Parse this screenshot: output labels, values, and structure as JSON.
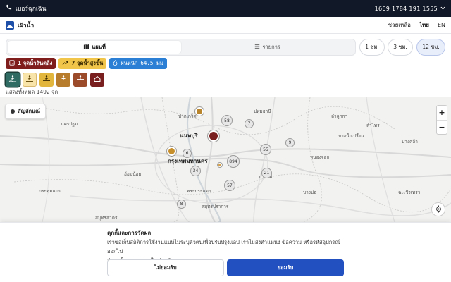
{
  "topbar": {
    "emergency_label": "เบอร์ฉุกเฉิน",
    "phones": "1669  1784  191  1555"
  },
  "header": {
    "app_name": "เฝ้าน้ำ",
    "help": "ช่วยเหลือ",
    "lang_th": "ไทย",
    "lang_en": "EN"
  },
  "view_toggle": {
    "map": "แผนที่",
    "list": "รายการ"
  },
  "time_ranges": [
    {
      "label": "1 ชม."
    },
    {
      "label": "3 ชม."
    },
    {
      "label": "12 ชม.",
      "active": true
    }
  ],
  "stats": {
    "critical": "1 จุดน้ำล้นตลิ่ง",
    "rising": "7 จุดน้ำสูงขึ้น",
    "rain_label": "ฝนหนัก",
    "rain_value": "64.5 มม"
  },
  "filters": [
    {
      "name": "filter-all",
      "color": "#2f6b63"
    },
    {
      "name": "filter-normal",
      "color": "#f8e3a8"
    },
    {
      "name": "filter-watch",
      "color": "#e2b53c"
    },
    {
      "name": "filter-warning",
      "color": "#b87d2c"
    },
    {
      "name": "filter-danger",
      "color": "#9b4a2a"
    },
    {
      "name": "filter-critical",
      "color": "#7a1f1f"
    }
  ],
  "count_text": "แสดงทั้งหมด 1492 จุด",
  "map": {
    "legend": "สัญลักษณ์",
    "labels": {
      "bangkok": "กรุงเทพมหานคร",
      "nonthaburi": "นนทบุรี",
      "pakkret": "ปากเกร็ด",
      "nakhonpathom": "นครปฐม",
      "samutprakan": "สมุทรปราการ",
      "samutsakhon": "สมุทรสาคร",
      "omnoi": "อ้อมน้อย",
      "pathumthani": "ปทุมธานี",
      "lamlukka": "ลำลูกกา",
      "bangnamprieo": "บางน้ำเปรี้ยว",
      "bangbo": "บางบ่อ",
      "bangphli": "บางพลี",
      "krathumbaen": "กระทุ่มแบน",
      "phraphradaeng": "พระประแดง",
      "lamsai": "ลำไทร",
      "chachoengsao": "ฉะเชิงเทรา",
      "nongchok": "หนองจอก",
      "bangkhla": "บางคล้า"
    },
    "clusters": [
      "58",
      "7",
      "55",
      "9",
      "6",
      "894",
      "21",
      "34",
      "57",
      "8"
    ],
    "zoom_in": "+",
    "zoom_out": "−"
  },
  "consent": {
    "title": "คุกกี้และการวัดผล",
    "body": "เราขอเก็บสถิติการใช้งานแบบไม่ระบุตัวตนเพื่อปรับปรุงแอป เราไม่ส่งตำแหน่ง ข้อความ หรือรหัสอุปกรณ์ออกไป",
    "link": "อ่านนโยบายความเป็นส่วนตัว",
    "decline": "ไม่ยอมรับ",
    "accept": "ยอมรับ"
  }
}
